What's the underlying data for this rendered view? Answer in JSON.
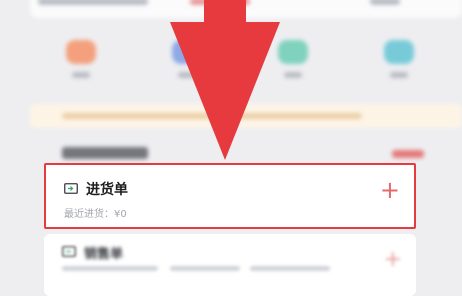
{
  "purchase_order": {
    "title": "进货单",
    "subtitle": "最近进货：¥0",
    "add_symbol": "+"
  },
  "sales_order": {
    "title": "销售单",
    "add_symbol": "+"
  },
  "colors": {
    "highlight_border": "#e63a3f",
    "arrow_fill": "#e63a3f",
    "plus_color": "#e36a6a",
    "icon_tiles": [
      "#f4a07c",
      "#8fa9e6",
      "#7fd2bd",
      "#77cbd9"
    ]
  },
  "icons": {
    "purchase": "document-import-icon",
    "sales": "document-export-icon",
    "add": "plus-icon",
    "pointer": "down-arrow-pointer"
  }
}
